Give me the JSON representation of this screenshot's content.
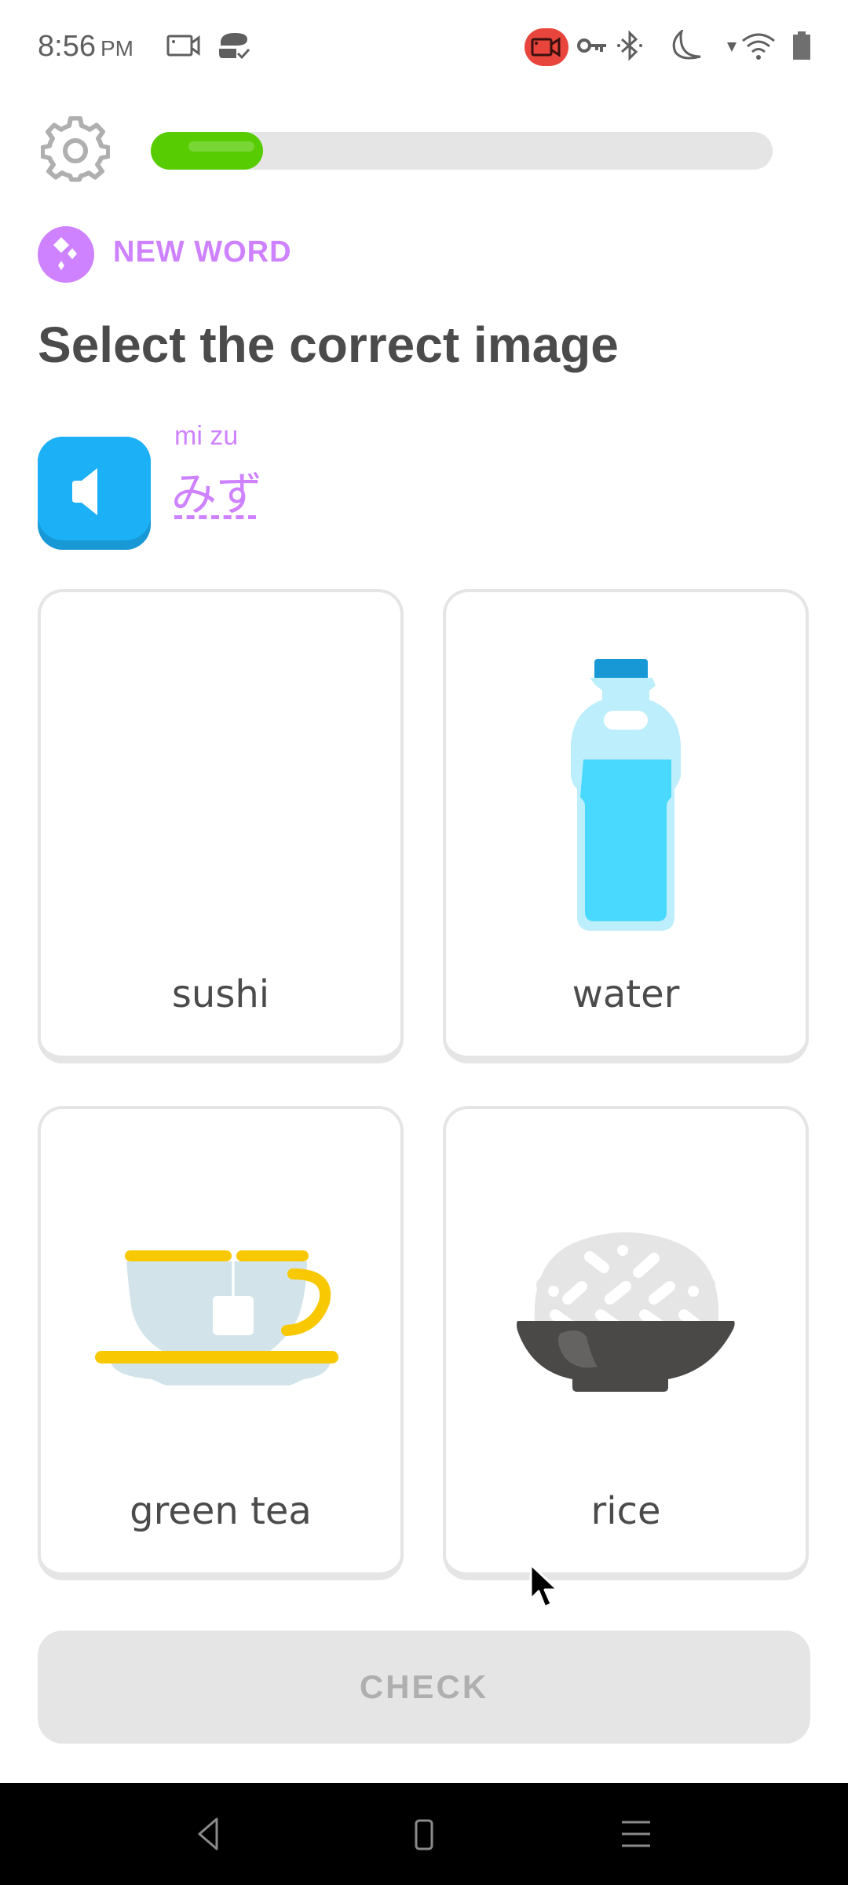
{
  "status_bar": {
    "time": "8:56",
    "ampm": "PM",
    "icons": [
      "screen-record-icon",
      "sync-icon",
      "recording-indicator-icon",
      "vpn-key-icon",
      "bluetooth-icon",
      "do-not-disturb-icon",
      "signal-icon",
      "wifi-icon",
      "battery-icon"
    ]
  },
  "header": {
    "settings_icon": "gear-icon",
    "progress": {
      "value": 0.18,
      "fill_color": "#58cc02",
      "track_color": "#e5e5e5"
    }
  },
  "challenge": {
    "badge_label": "NEW WORD",
    "badge_color": "#ce82ff",
    "title": "Select the correct image",
    "audio_icon": "speaker-icon",
    "audio_color": "#1cb0f6",
    "prompt_romaji": "mi zu",
    "prompt_kana": "みず"
  },
  "options": [
    {
      "label": "sushi",
      "image": "none"
    },
    {
      "label": "water",
      "image": "water-bottle"
    },
    {
      "label": "green tea",
      "image": "teacup"
    },
    {
      "label": "rice",
      "image": "rice-bowl"
    }
  ],
  "footer": {
    "check_label": "CHECK",
    "check_disabled": true
  },
  "nav_bar": {
    "buttons": [
      "back",
      "home",
      "menu"
    ]
  }
}
